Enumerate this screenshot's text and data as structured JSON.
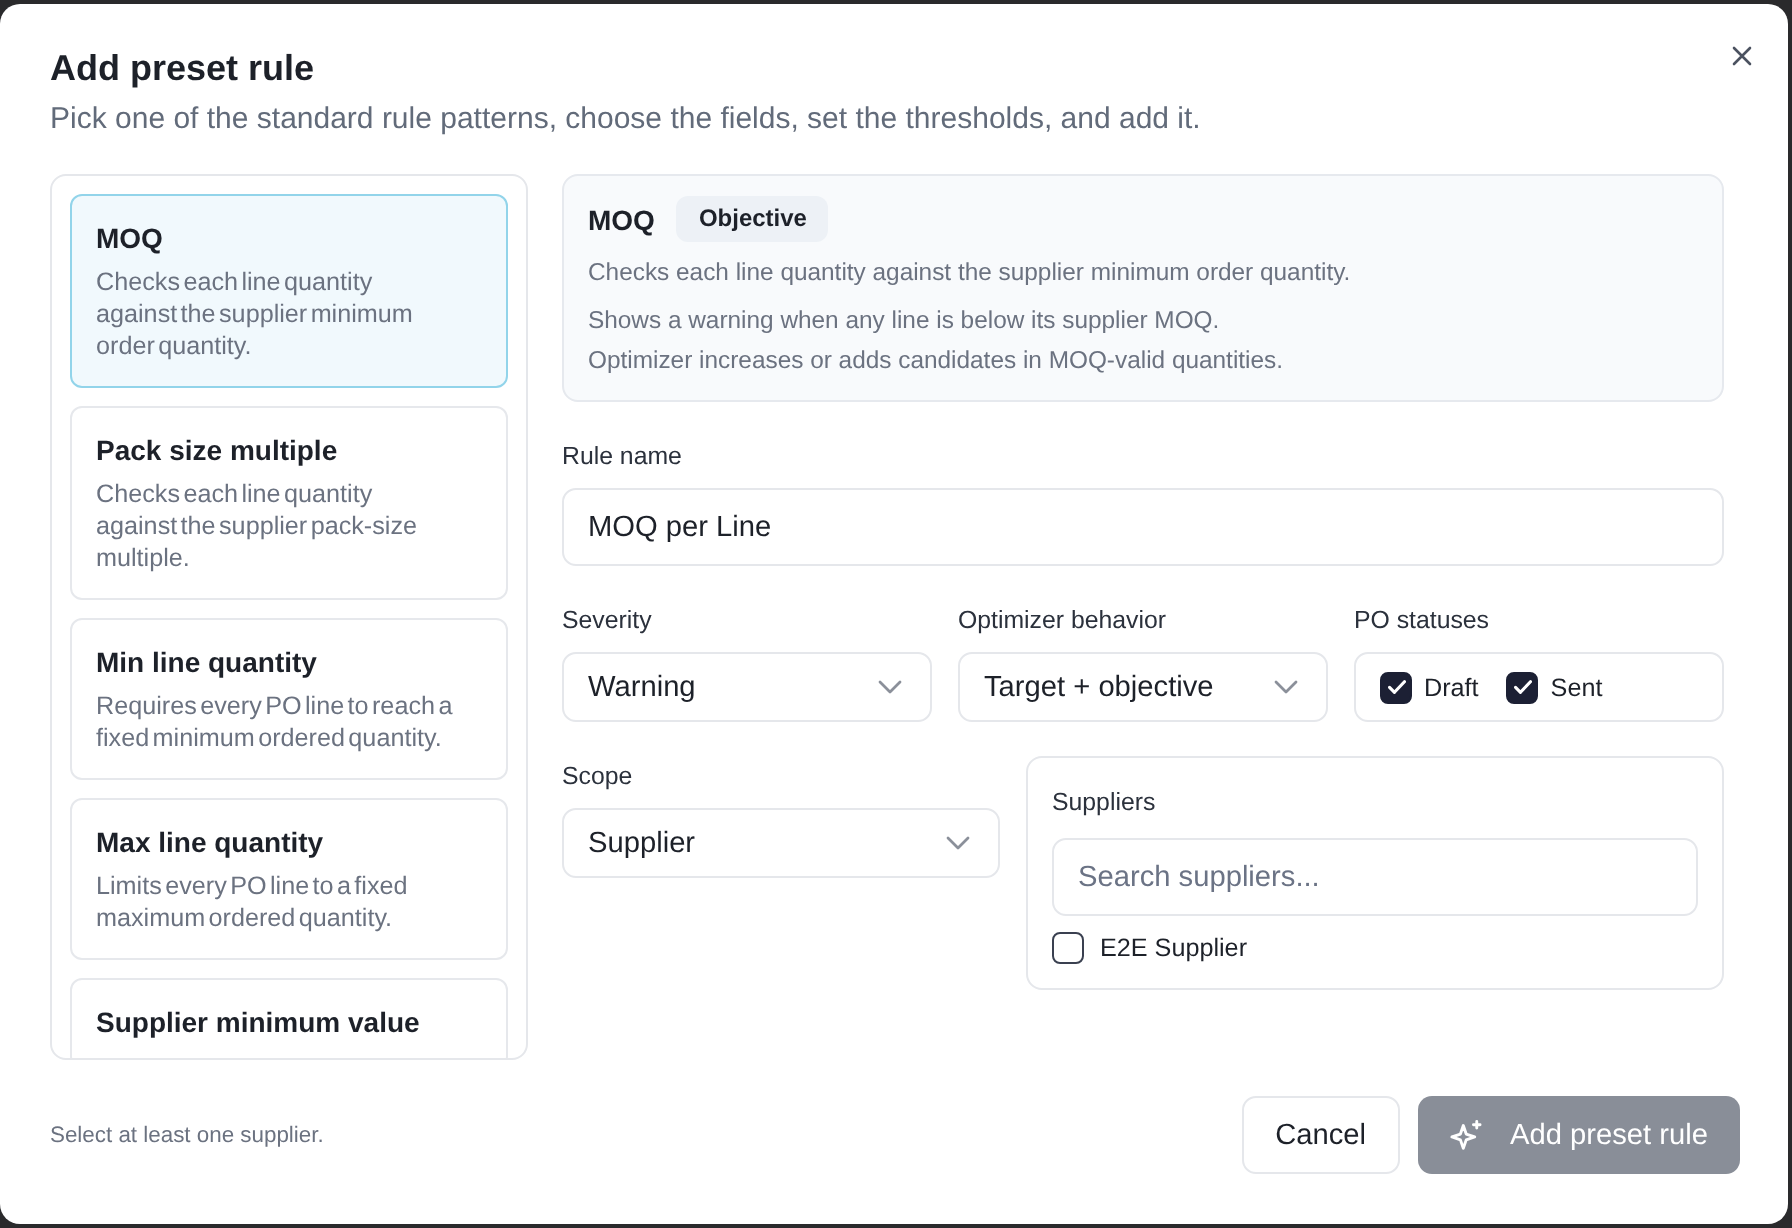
{
  "dialog": {
    "title": "Add preset rule",
    "subtitle": "Pick one of the standard rule patterns, choose the fields, set the thresholds, and add it."
  },
  "presets": [
    {
      "title": "MOQ",
      "description": "Checks each line quantity against the supplier minimum order quantity.",
      "selected": true
    },
    {
      "title": "Pack size multiple",
      "description": "Checks each line quantity against the supplier pack-size multiple.",
      "selected": false
    },
    {
      "title": "Min line quantity",
      "description": "Requires every PO line to reach a fixed minimum ordered quantity.",
      "selected": false
    },
    {
      "title": "Max line quantity",
      "description": "Limits every PO line to a fixed maximum ordered quantity.",
      "selected": false
    },
    {
      "title": "Supplier minimum value",
      "selected": false
    }
  ],
  "detail": {
    "title": "MOQ",
    "badge": "Objective",
    "description": "Checks each line quantity against the supplier minimum order quantity.",
    "notes": [
      "Shows a warning when any line is below its supplier MOQ.",
      "Optimizer increases or adds candidates in MOQ-valid quantities."
    ]
  },
  "form": {
    "rule_name": {
      "label": "Rule name",
      "value": "MOQ per Line"
    },
    "severity": {
      "label": "Severity",
      "value": "Warning"
    },
    "optimizer_behavior": {
      "label": "Optimizer behavior",
      "value": "Target + objective"
    },
    "po_statuses": {
      "label": "PO statuses",
      "options": [
        {
          "label": "Draft",
          "checked": true
        },
        {
          "label": "Sent",
          "checked": true
        }
      ]
    },
    "scope": {
      "label": "Scope",
      "value": "Supplier"
    },
    "suppliers": {
      "label": "Suppliers",
      "placeholder": "Search suppliers...",
      "options": [
        {
          "label": "E2E Supplier",
          "checked": false
        }
      ]
    }
  },
  "footer": {
    "hint": "Select at least one supplier.",
    "buttons": [
      {
        "label": "Cancel",
        "kind": "secondary",
        "disabled": false
      },
      {
        "label": "Add preset rule",
        "kind": "primary",
        "disabled": true
      }
    ]
  }
}
